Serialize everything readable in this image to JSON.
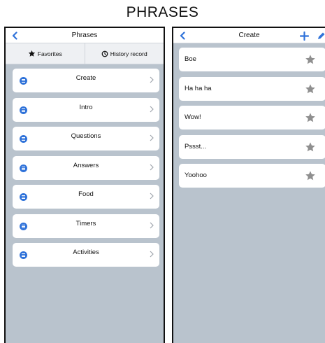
{
  "page": {
    "title": "PHRASES"
  },
  "left_screen": {
    "nav_title": "Phrases",
    "tabs": [
      {
        "label": "Favorites",
        "icon": "star-icon"
      },
      {
        "label": "History record",
        "icon": "history-icon"
      }
    ],
    "categories": [
      {
        "label": "Create"
      },
      {
        "label": "Intro"
      },
      {
        "label": "Questions"
      },
      {
        "label": "Answers"
      },
      {
        "label": "Food"
      },
      {
        "label": "Timers"
      },
      {
        "label": "Activities"
      }
    ]
  },
  "right_screen": {
    "nav_title": "Create",
    "phrases": [
      {
        "text": "Boe"
      },
      {
        "text": "Ha ha ha"
      },
      {
        "text": "Wow!"
      },
      {
        "text": "Pssst..."
      },
      {
        "text": "Yoohoo"
      }
    ]
  },
  "colors": {
    "accent": "#2f72d9",
    "background": "#b9c3cd",
    "star": "#8f8f8f"
  }
}
